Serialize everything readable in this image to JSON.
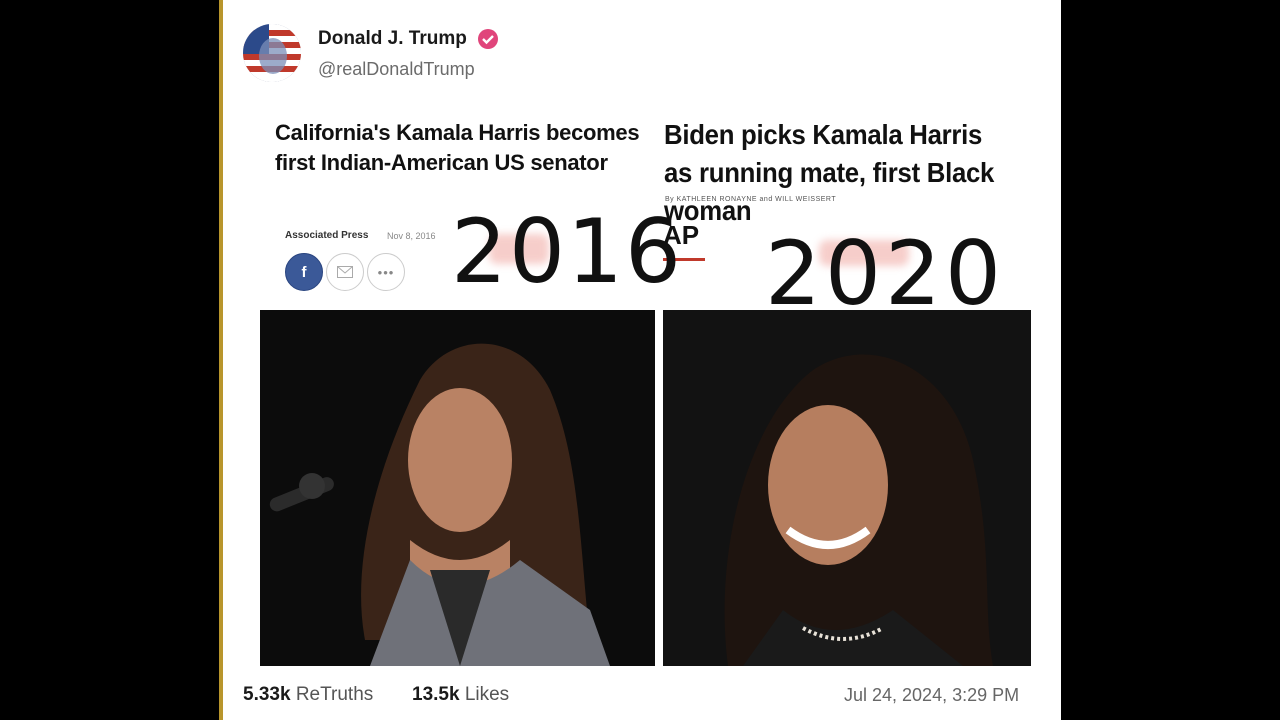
{
  "post": {
    "author_name": "Donald J. Trump",
    "handle": "@realDonaldTrump",
    "verified_icon": "verified-badge-icon",
    "timestamp": "Jul 24, 2024, 3:29 PM"
  },
  "image": {
    "left_headline": "California's Kamala Harris becomes first Indian-American US senator",
    "left_source": "Associated Press",
    "left_date": "Nov 8, 2016",
    "right_headline": "Biden picks Kamala Harris as running mate, first Black woman",
    "right_byline": "By KATHLEEN RONAYNE and WILL WEISSERT",
    "right_ap_logo": "AP",
    "year_left": "2016",
    "year_right": "2020",
    "share_icons": [
      "facebook-icon",
      "mail-icon",
      "more-icon"
    ],
    "accent_colors": {
      "facebook": "#3b5998",
      "ap_red": "#c0392b",
      "verified": "#e0457b"
    }
  },
  "stats": {
    "retruths_count": "5.33k",
    "retruths_label": "ReTruths",
    "likes_count": "13.5k",
    "likes_label": "Likes"
  }
}
